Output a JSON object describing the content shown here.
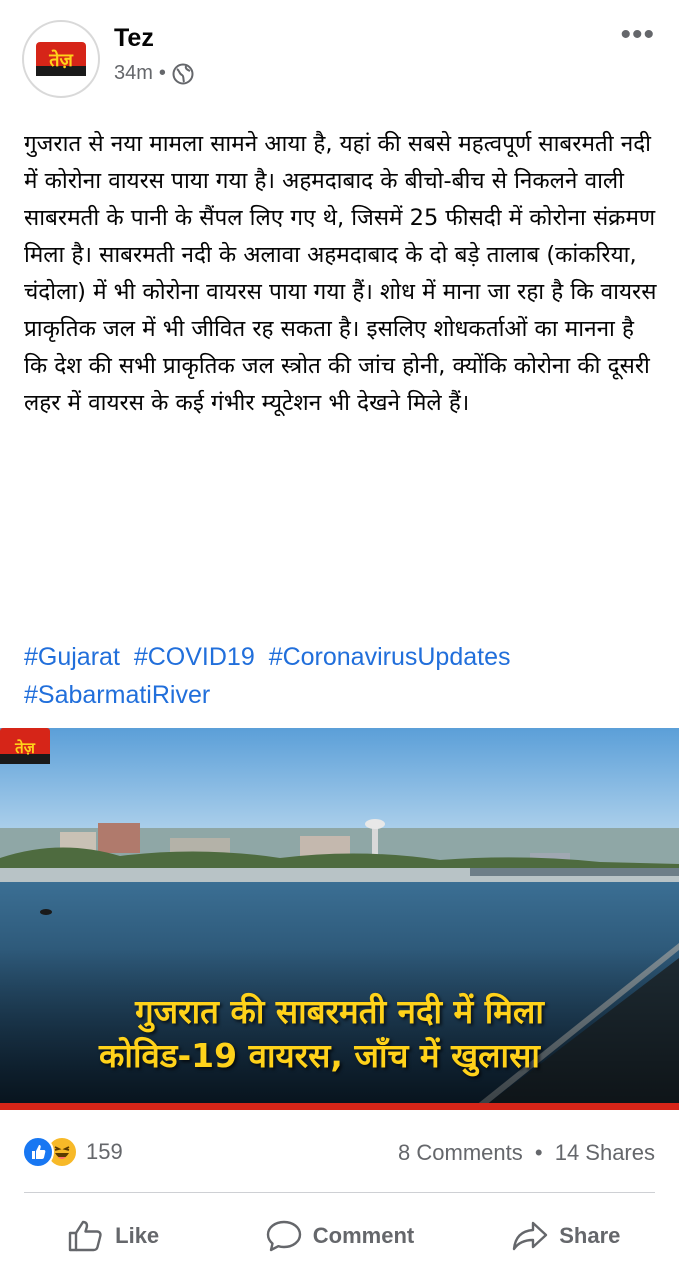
{
  "post": {
    "page_name": "Tez",
    "avatar_text": "तेज़",
    "time": "34m",
    "dot": "•",
    "more": "•••",
    "text": "गुजरात से नया मामला सामने आया है, यहां की सबसे महत्वपूर्ण साबरमती नदी में कोरोना वायरस पाया गया है। अहमदाबाद के बीचो-बीच से निकलने वाली साबरमती के पानी के सैंपल लिए गए थे, जिसमें 25 फीसदी में कोरोना संक्रमण मिला है। साबरमती नदी के अलावा अहमदाबाद के दो बड़े तालाब (कांकरिया, चंदोला) में भी कोरोना वायरस पाया गया हैं। शोध में माना जा रहा है कि वायरस प्राकृतिक जल में भी जीवित रह सकता है। इसलिए शोधकर्ताओं का मानना है कि देश की सभी प्राकृतिक जल स्त्रोत की जांच होनी, क्योंकि कोरोना की दूसरी लहर में वायरस के कई गंभीर म्यूटेशन भी देखने मिले हैं।",
    "hashtags": [
      "#Gujarat",
      "#COVID19",
      "#CoronavirusUpdates",
      "#SabarmatiRiver"
    ]
  },
  "image": {
    "headline_line1": "गुजरात की साबरमती नदी में मिला",
    "headline_line2": "कोविड-19 वायरस, जाँच में खुलासा",
    "logo_text": "तेज़"
  },
  "stats": {
    "reaction_count": "159",
    "comments": "8 Comments",
    "separator": "•",
    "shares": "14 Shares"
  },
  "actions": {
    "like": "Like",
    "comment": "Comment",
    "share": "Share"
  },
  "colors": {
    "link": "#216fdb",
    "secondary_text": "#65676b",
    "brand_red": "#d62518",
    "brand_yellow": "#ffd21a"
  }
}
